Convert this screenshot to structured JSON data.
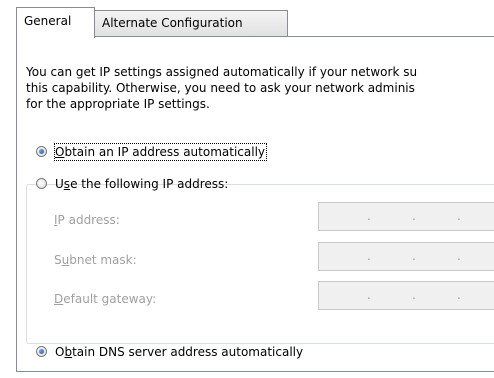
{
  "tabs": [
    {
      "label": "General",
      "selected": true
    },
    {
      "label": "Alternate Configuration",
      "selected": false
    }
  ],
  "description": "You can get IP settings assigned automatically if your network su\nthis capability. Otherwise, you need to ask your network adminis\nfor the appropriate IP settings.",
  "radios": {
    "auto_ip": {
      "before": "",
      "mnemonic": "O",
      "after": "btain an IP address automatically",
      "checked": true
    },
    "static_ip": {
      "before": "U",
      "mnemonic": "s",
      "after": "e the following IP address:",
      "checked": false
    },
    "auto_dns": {
      "before": "O",
      "mnemonic": "b",
      "after": "tain DNS server address automatically",
      "checked": true
    }
  },
  "fields": [
    {
      "before": "",
      "mnemonic": "I",
      "after": "P address:",
      "value": ". . ."
    },
    {
      "before": "S",
      "mnemonic": "u",
      "after": "bnet mask:",
      "value": ". . ."
    },
    {
      "before": "",
      "mnemonic": "D",
      "after": "efault gateway:",
      "value": ". . ."
    }
  ],
  "colors": {
    "border": "#898c95",
    "radio_selected": "#1a4f9c",
    "disabled_text": "#a0a0a0",
    "disabled_field_bg": "#f0f0f0"
  }
}
